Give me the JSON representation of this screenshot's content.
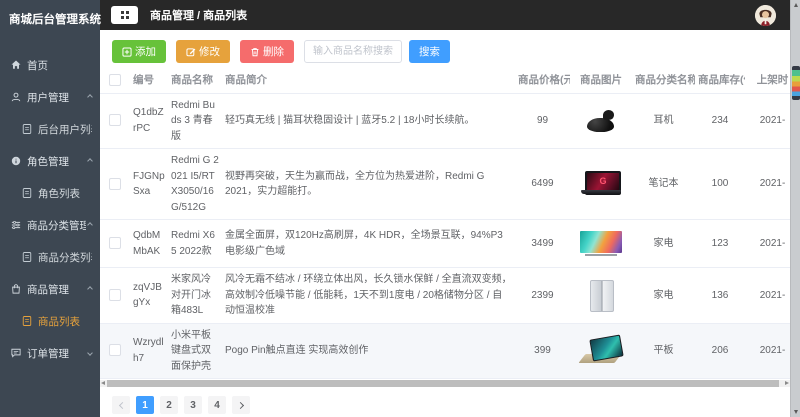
{
  "app_title": "商城后台管理系统",
  "header": {
    "breadcrumb": "商品管理 / 商品列表",
    "menu_button_icon": "grid-icon",
    "avatar_icon": "user-avatar"
  },
  "sidebar": {
    "items": [
      {
        "label": "首页",
        "icon": "home-icon",
        "level": "top"
      },
      {
        "label": "用户管理",
        "icon": "user-icon",
        "level": "group",
        "expanded": true
      },
      {
        "label": "后台用户列表",
        "icon": "document-icon",
        "level": "sub"
      },
      {
        "label": "角色管理",
        "icon": "info-circle-icon",
        "level": "group",
        "expanded": true
      },
      {
        "label": "角色列表",
        "icon": "document-icon",
        "level": "sub"
      },
      {
        "label": "商品分类管理",
        "icon": "category-filter-icon",
        "level": "group",
        "expanded": true
      },
      {
        "label": "商品分类列表",
        "icon": "document-icon",
        "level": "sub"
      },
      {
        "label": "商品管理",
        "icon": "shopping-bag-icon",
        "level": "group",
        "expanded": true
      },
      {
        "label": "商品列表",
        "icon": "document-icon",
        "level": "sub",
        "active": true
      },
      {
        "label": "订单管理",
        "icon": "order-chat-icon",
        "level": "group",
        "expanded": false
      }
    ]
  },
  "toolbar": {
    "add_label": "添加",
    "add_icon": "plus-square-icon",
    "edit_label": "修改",
    "edit_icon": "edit-pencil-icon",
    "delete_label": "删除",
    "delete_icon": "trash-icon",
    "search_placeholder": "输入商品名称搜索...",
    "search_label": "搜索"
  },
  "table": {
    "columns": [
      "编号",
      "商品名称",
      "商品简介",
      "商品价格(元)",
      "商品图片",
      "商品分类名称",
      "商品库存(件)",
      "上架时"
    ],
    "rows": [
      {
        "id": "Q1dbZrPC",
        "name": "Redmi Buds 3 青春版",
        "desc": "轻巧真无线 | 猫耳状稳固设计 | 蓝牙5.2 | 18小时长续航。",
        "price": "99",
        "image": "earbuds",
        "category": "耳机",
        "stock": "234",
        "date": "2021-"
      },
      {
        "id": "FJGNpSxa",
        "name": "Redmi G 2021 I5/RTX3050/16G/512G",
        "desc": "视野再突破，天生为赢而战，全方位为热爱进阶，Redmi G 2021，实力超能打。",
        "price": "6499",
        "image": "laptop",
        "category": "笔记本",
        "stock": "100",
        "date": "2021-"
      },
      {
        "id": "QdbMMbAK",
        "name": "Redmi X65 2022款",
        "desc": "金属全面屏，双120Hz高刷屏，4K HDR，全场景互联，94%P3电影级广色域",
        "price": "3499",
        "image": "tv",
        "category": "家电",
        "stock": "123",
        "date": "2021-"
      },
      {
        "id": "zqVJBgYx",
        "name": "米家风冷对开门冰箱483L",
        "desc": "风冷无霜不结冰 / 环绕立体出风，长久锁水保鲜 / 全直流双变频，高效制冷低噪节能 / 低能耗，1天不到1度电 / 20格储物分区 / 自动恒温校准",
        "price": "2399",
        "image": "fridge",
        "category": "家电",
        "stock": "136",
        "date": "2021-"
      },
      {
        "id": "Wzrydlh7",
        "name": "小米平板 键盘式双面保护壳",
        "desc": "Pogo Pin触点直连 实现高效创作",
        "price": "399",
        "image": "tablet",
        "category": "平板",
        "stock": "206",
        "date": "2021-",
        "highlighted": true
      }
    ]
  },
  "pagination": {
    "prev_icon": "chevron-left-icon",
    "pages": [
      "1",
      "2",
      "3",
      "4"
    ],
    "active_page": "1",
    "next_icon": "chevron-right-icon"
  },
  "colors": {
    "primary": "#409eff",
    "success": "#67c23a",
    "warning": "#e6a23c",
    "danger": "#f56c6c",
    "sidebar_bg": "#3d4752",
    "header_bg": "#282828",
    "active_menu": "#e6a23c",
    "row_highlight": "#f5f7fa"
  }
}
